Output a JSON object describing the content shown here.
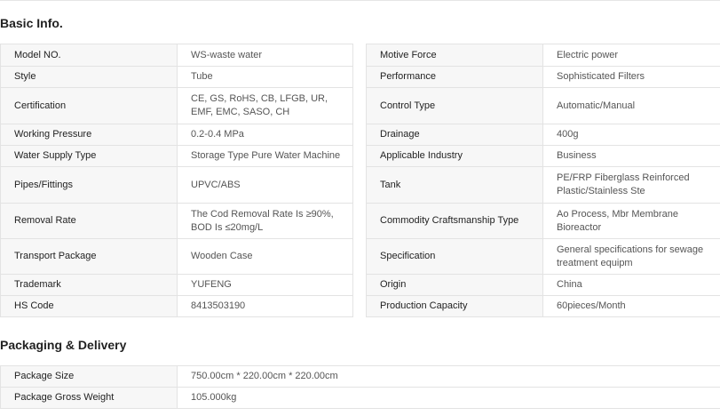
{
  "basic": {
    "title": "Basic Info.",
    "left": [
      {
        "k": "Model NO.",
        "v": "WS-waste water"
      },
      {
        "k": "Style",
        "v": "Tube"
      },
      {
        "k": "Certification",
        "v": "CE, GS, RoHS, CB, LFGB, UR, EMF, EMC, SASO, CH"
      },
      {
        "k": "Working Pressure",
        "v": "0.2-0.4 MPa"
      },
      {
        "k": "Water Supply Type",
        "v": "Storage Type Pure Water Machine"
      },
      {
        "k": "Pipes/Fittings",
        "v": "UPVC/ABS"
      },
      {
        "k": "Removal Rate",
        "v": "The Cod Removal Rate Is ≥90%, BOD Is ≤20mg/L"
      },
      {
        "k": "Transport Package",
        "v": "Wooden Case"
      },
      {
        "k": "Trademark",
        "v": "YUFENG"
      },
      {
        "k": "HS Code",
        "v": "8413503190"
      }
    ],
    "right": [
      {
        "k": "Motive Force",
        "v": "Electric power"
      },
      {
        "k": "Performance",
        "v": "Sophisticated Filters"
      },
      {
        "k": "Control Type",
        "v": "Automatic/Manual"
      },
      {
        "k": "Drainage",
        "v": "400g"
      },
      {
        "k": "Applicable Industry",
        "v": "Business"
      },
      {
        "k": "Tank",
        "v": "PE/FRP Fiberglass Reinforced Plastic/Stainless Ste"
      },
      {
        "k": "Commodity Craftsmanship Type",
        "v": "Ao Process, Mbr Membrane Bioreactor"
      },
      {
        "k": "Specification",
        "v": "General specifications for sewage treatment equipm"
      },
      {
        "k": "Origin",
        "v": "China"
      },
      {
        "k": "Production Capacity",
        "v": "60pieces/Month"
      }
    ]
  },
  "packaging": {
    "title": "Packaging & Delivery",
    "rows": [
      {
        "k": "Package Size",
        "v": "750.00cm * 220.00cm * 220.00cm"
      },
      {
        "k": "Package Gross Weight",
        "v": "105.000kg"
      }
    ]
  }
}
